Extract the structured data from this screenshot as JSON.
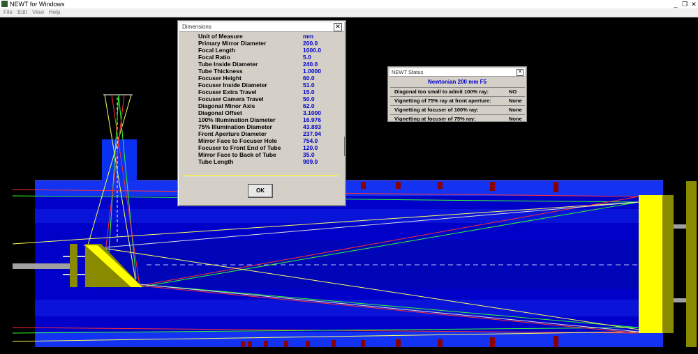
{
  "app": {
    "title": "NEWT for Windows",
    "window_buttons": {
      "minimize": "_",
      "maximize": "❐",
      "close": "✕"
    }
  },
  "menu": [
    "File",
    "Edit",
    "View",
    "Help"
  ],
  "dimensions_dialog": {
    "title": "Dimensions",
    "close_glyph": "✕",
    "rows": [
      {
        "label": "Unit of Measure",
        "value": "mm"
      },
      {
        "label": "Primary Mirror Diameter",
        "value": "200.0"
      },
      {
        "label": "Focal Length",
        "value": "1000.0"
      },
      {
        "label": "Focal Ratio",
        "value": "5.0"
      },
      {
        "label": "Tube Inside Diameter",
        "value": "240.0"
      },
      {
        "label": "Tube Thickness",
        "value": "1.0000"
      },
      {
        "label": "Focuser Height",
        "value": "60.0"
      },
      {
        "label": "Focuser Inside Diameter",
        "value": "51.0"
      },
      {
        "label": "Focuser Extra Travel",
        "value": "15.0"
      },
      {
        "label": "Focuser Camera Travel",
        "value": "50.0"
      },
      {
        "label": "Diagonal Minor Axis",
        "value": "62.0"
      },
      {
        "label": "Diagonal Offset",
        "value": "3.1000"
      },
      {
        "label": "100% Illumination Diameter",
        "value": "16.976"
      },
      {
        "label": "75% Illumination Diameter",
        "value": "43.893"
      },
      {
        "label": "Front Aperture Diameter",
        "value": "237.94"
      },
      {
        "label": "Mirror Face to Focuser Hole",
        "value": "754.0"
      },
      {
        "label": "Focuser to Front End of Tube",
        "value": "120.0"
      },
      {
        "label": "Mirror Face to Back of Tube",
        "value": "35.0"
      },
      {
        "label": "Tube Length",
        "value": "909.0"
      }
    ],
    "ok_label": "OK"
  },
  "status_dialog": {
    "title": "NEWT Status",
    "close_glyph": "✕",
    "heading": "Newtonian 200 mm F5",
    "rows": [
      {
        "label": "Diagonal too small to admit 100% ray:",
        "value": "NO"
      },
      {
        "label": "Vignetting of 75% ray at front aperture:",
        "value": "None"
      },
      {
        "label": "Vignetting at focuser of 100% ray:",
        "value": "None"
      },
      {
        "label": "Vignetting at focuser of 75% ray:",
        "value": "None"
      }
    ]
  },
  "colors": {
    "background": "#000000",
    "tube_dark": "#0000cc",
    "tube_mid": "#0018e8",
    "tube_edge": "#2a3cf0",
    "mirror": "#ffff00",
    "cell_olive": "#8a8a00",
    "baffle_red": "#8b0000",
    "value_blue": "#0000cc"
  }
}
